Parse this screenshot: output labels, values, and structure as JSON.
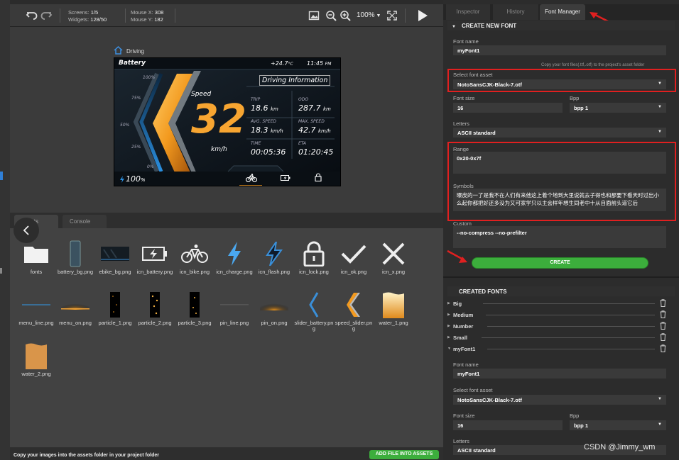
{
  "toolbar": {
    "screens_label": "Screens:",
    "screens_value": "1/5",
    "widgets_label": "Widgets:",
    "widgets_value": "128/50",
    "mouse_x_label": "Mouse X:",
    "mouse_x_value": "308",
    "mouse_y_label": "Mouse Y:",
    "mouse_y_value": "182",
    "zoom": "100%"
  },
  "canvas": {
    "breadcrumb": "Driving"
  },
  "dashboard": {
    "battery_label": "Battery",
    "temp": "+24.7",
    "temp_unit": "°C",
    "time": "11:45",
    "time_unit": "PM",
    "info_title": "Driving Information",
    "pct_100": "100%",
    "pct_75": "75%",
    "pct_50": "50%",
    "pct_25": "25%",
    "pct_0": "0%",
    "speed_label": "Speed",
    "speed_value": "32",
    "speed_unit": "km/h",
    "trip_label": "TRIP",
    "trip_value": "18.6",
    "trip_unit": "km",
    "odo_label": "ODO",
    "odo_value": "287.7",
    "odo_unit": "km",
    "avg_label": "AVG. SPEED",
    "avg_value": "18.3",
    "avg_unit": "km/h",
    "max_label": "MAX. SPEED",
    "max_value": "42.7",
    "max_unit": "km/h",
    "time_label": "TIME",
    "time_value": "00:05:36",
    "eta_label": "ETA",
    "eta_value": "01:20:45",
    "battery_value": "100",
    "battery_unit": "%"
  },
  "assets": {
    "tabs": [
      "Assets",
      "Console"
    ],
    "items": [
      {
        "name": "fonts",
        "icon": "folder-icon"
      },
      {
        "name": "battery_bg.png",
        "icon": "battery-bg-thumb"
      },
      {
        "name": "ebike_bg.png",
        "icon": "ebike-bg-thumb"
      },
      {
        "name": "icn_battery.png",
        "icon": "battery-icon"
      },
      {
        "name": "icn_bike.png",
        "icon": "bike-icon"
      },
      {
        "name": "icn_charge.png",
        "icon": "charge-icon"
      },
      {
        "name": "icn_flash.png",
        "icon": "flash-icon"
      },
      {
        "name": "icn_lock.png",
        "icon": "lock-icon"
      },
      {
        "name": "icn_ok.png",
        "icon": "check-icon"
      },
      {
        "name": "icn_x.png",
        "icon": "x-icon"
      },
      {
        "name": "menu_line.png",
        "icon": "menu-line-thumb"
      },
      {
        "name": "menu_on.png",
        "icon": "menu-on-thumb"
      },
      {
        "name": "particle_1.png",
        "icon": "particle-thumb"
      },
      {
        "name": "particle_2.png",
        "icon": "particle-thumb"
      },
      {
        "name": "particle_3.png",
        "icon": "particle-thumb"
      },
      {
        "name": "pin_line.png",
        "icon": "pin-line-thumb"
      },
      {
        "name": "pin_on.png",
        "icon": "pin-on-thumb"
      },
      {
        "name": "slider_battery.png",
        "icon": "slider-battery-thumb"
      },
      {
        "name": "speed_slider.png",
        "icon": "speed-slider-thumb"
      },
      {
        "name": "water_1.png",
        "icon": "water-thumb"
      },
      {
        "name": "water_2.png",
        "icon": "water-thumb"
      }
    ],
    "footer_text": "Copy your images into the assets folder in your project folder",
    "add_button": "ADD FILE INTO ASSETS"
  },
  "rpanel": {
    "tabs": [
      "Inspector",
      "History",
      "Font Manager"
    ],
    "create_header": "CREATE NEW FONT",
    "font_name_label": "Font name",
    "font_name_value": "myFont1",
    "copy_hint": "Copy your font files(.ttf,.otf) to the project's asset folder",
    "select_asset_label": "Select font asset",
    "select_asset_value": "NotoSansCJK-Black-7.otf",
    "font_size_label": "Font size",
    "font_size_value": "16",
    "bpp_label": "Bpp",
    "bpp_value": "bpp 1",
    "letters_label": "Letters",
    "letters_value": "ASCII standard",
    "range_label": "Range",
    "range_value": "0x20-0x7f",
    "symbols_label": "Symbols",
    "symbols_value": "曝皮的一了是我不在人们有来他这上着个地到大里说就去子得也和那要下看天时过出小么起你都把好还多没为又可家学只以主会样年想生同老中十从自面前头道它后",
    "custom_label": "Custom",
    "custom_value": "--no-compress --no-prefilter",
    "create_button": "CREATE",
    "created_header": "CREATED FONTS",
    "created_fonts": [
      "Big",
      "Medium",
      "Number",
      "Small",
      "myFont1"
    ],
    "edit_font_name_label": "Font name",
    "edit_font_name_value": "myFont1",
    "edit_select_asset_label": "Select font asset",
    "edit_select_asset_value": "NotoSansCJK-Black-7.otf",
    "edit_font_size_label": "Font size",
    "edit_font_size_value": "16",
    "edit_bpp_label": "Bpp",
    "edit_bpp_value": "bpp 1",
    "edit_letters_label": "Letters",
    "edit_letters_value": "ASCII standard"
  },
  "watermark": "CSDN @Jimmy_wm",
  "colors": {
    "accent_green": "#3cae3c",
    "annotation_red": "#e02020",
    "dashboard_orange": "#f39a1f",
    "dashboard_blue": "#2a8fe0"
  }
}
